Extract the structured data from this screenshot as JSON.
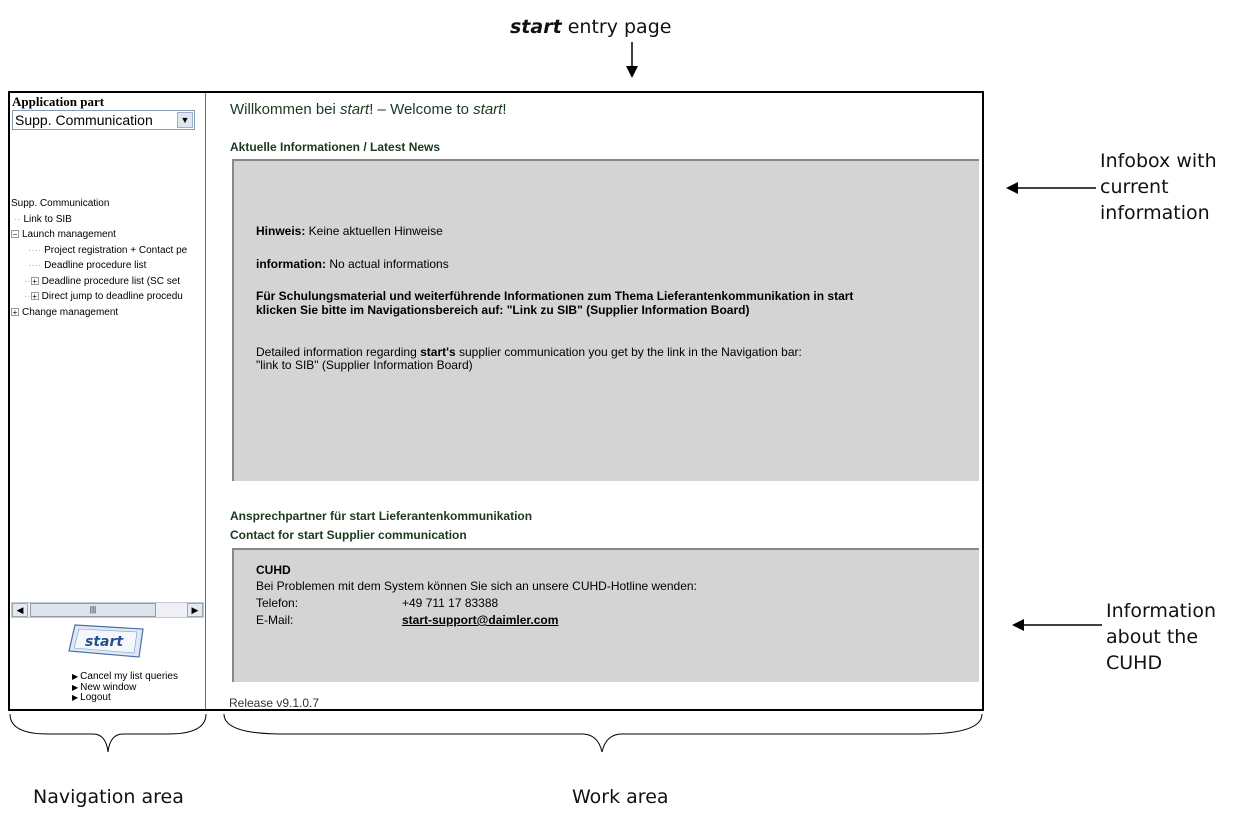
{
  "annotations": {
    "entry_page_bold": "start",
    "entry_page_rest": " entry page",
    "infobox": [
      "Infobox with",
      "current",
      "information"
    ],
    "cuhd": [
      "Information",
      "about the",
      "CUHD"
    ],
    "navigation_area": "Navigation area",
    "work_area": "Work area"
  },
  "nav": {
    "heading": "Application part",
    "select_value": "Supp. Communication",
    "tree": [
      {
        "label": "Supp. Communication",
        "level": 0,
        "toggle": ""
      },
      {
        "label": "Link to SIB",
        "level": 1,
        "toggle": ""
      },
      {
        "label": "Launch management",
        "level": 1,
        "toggle": "−"
      },
      {
        "label": "Project registration + Contact pe",
        "level": 2,
        "toggle": ""
      },
      {
        "label": "Deadline procedure list",
        "level": 2,
        "toggle": ""
      },
      {
        "label": "Deadline procedure list (SC set",
        "level": 2,
        "toggle": "+"
      },
      {
        "label": "Direct jump to deadline procedu",
        "level": 2,
        "toggle": "+"
      },
      {
        "label": "Change management",
        "level": 1,
        "toggle": "+"
      }
    ],
    "logo_text": "start",
    "links": [
      "Cancel my list queries",
      "New window",
      "Logout"
    ]
  },
  "work": {
    "welcome": {
      "a": "Willkommen bei ",
      "b": "start",
      "c": "!  –  Welcome to ",
      "d": "start",
      "e": "!"
    },
    "news_title": "Aktuelle Informationen / Latest News",
    "news": {
      "hinweis_label": "Hinweis:",
      "hinweis_text": " Keine aktuellen Hinweise",
      "info_label": "information:",
      "info_text": " No actual informations",
      "schulung_line1": "Für Schulungsmaterial und weiterführende Informationen zum Thema Lieferantenkommunikation in start",
      "schulung_line2": "klicken Sie bitte im Navigationsbereich auf: \"Link zu SIB\" (Supplier Information Board)",
      "detail_a": "Detailed information regarding ",
      "detail_b": "start's",
      "detail_c": " supplier communication you get by the link in the Navigation bar:",
      "detail_line2": "\"link to SIB\" (Supplier Information Board)"
    },
    "contact_title_1": "Ansprechpartner für start Lieferantenkommunikation",
    "contact_title_2": "Contact for start Supplier communication",
    "cuhd": {
      "title": "CUHD",
      "desc": "Bei Problemen mit dem System können Sie sich an unsere CUHD-Hotline wenden:",
      "phone_label": "Telefon:",
      "phone_value": "+49 711 17 83388",
      "email_label": "E-Mail:",
      "email_value": "start-support@daimler.com"
    },
    "release": "Release v9.1.0.7"
  }
}
